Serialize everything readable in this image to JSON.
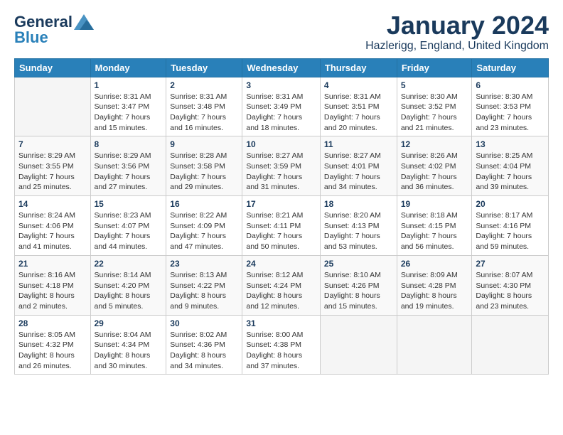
{
  "header": {
    "logo_line1": "General",
    "logo_line2": "Blue",
    "month_title": "January 2024",
    "location": "Hazlerigg, England, United Kingdom"
  },
  "days_of_week": [
    "Sunday",
    "Monday",
    "Tuesday",
    "Wednesday",
    "Thursday",
    "Friday",
    "Saturday"
  ],
  "weeks": [
    [
      {
        "day": "",
        "sunrise": "",
        "sunset": "",
        "daylight": ""
      },
      {
        "day": "1",
        "sunrise": "Sunrise: 8:31 AM",
        "sunset": "Sunset: 3:47 PM",
        "daylight": "Daylight: 7 hours and 15 minutes."
      },
      {
        "day": "2",
        "sunrise": "Sunrise: 8:31 AM",
        "sunset": "Sunset: 3:48 PM",
        "daylight": "Daylight: 7 hours and 16 minutes."
      },
      {
        "day": "3",
        "sunrise": "Sunrise: 8:31 AM",
        "sunset": "Sunset: 3:49 PM",
        "daylight": "Daylight: 7 hours and 18 minutes."
      },
      {
        "day": "4",
        "sunrise": "Sunrise: 8:31 AM",
        "sunset": "Sunset: 3:51 PM",
        "daylight": "Daylight: 7 hours and 20 minutes."
      },
      {
        "day": "5",
        "sunrise": "Sunrise: 8:30 AM",
        "sunset": "Sunset: 3:52 PM",
        "daylight": "Daylight: 7 hours and 21 minutes."
      },
      {
        "day": "6",
        "sunrise": "Sunrise: 8:30 AM",
        "sunset": "Sunset: 3:53 PM",
        "daylight": "Daylight: 7 hours and 23 minutes."
      }
    ],
    [
      {
        "day": "7",
        "sunrise": "Sunrise: 8:29 AM",
        "sunset": "Sunset: 3:55 PM",
        "daylight": "Daylight: 7 hours and 25 minutes."
      },
      {
        "day": "8",
        "sunrise": "Sunrise: 8:29 AM",
        "sunset": "Sunset: 3:56 PM",
        "daylight": "Daylight: 7 hours and 27 minutes."
      },
      {
        "day": "9",
        "sunrise": "Sunrise: 8:28 AM",
        "sunset": "Sunset: 3:58 PM",
        "daylight": "Daylight: 7 hours and 29 minutes."
      },
      {
        "day": "10",
        "sunrise": "Sunrise: 8:27 AM",
        "sunset": "Sunset: 3:59 PM",
        "daylight": "Daylight: 7 hours and 31 minutes."
      },
      {
        "day": "11",
        "sunrise": "Sunrise: 8:27 AM",
        "sunset": "Sunset: 4:01 PM",
        "daylight": "Daylight: 7 hours and 34 minutes."
      },
      {
        "day": "12",
        "sunrise": "Sunrise: 8:26 AM",
        "sunset": "Sunset: 4:02 PM",
        "daylight": "Daylight: 7 hours and 36 minutes."
      },
      {
        "day": "13",
        "sunrise": "Sunrise: 8:25 AM",
        "sunset": "Sunset: 4:04 PM",
        "daylight": "Daylight: 7 hours and 39 minutes."
      }
    ],
    [
      {
        "day": "14",
        "sunrise": "Sunrise: 8:24 AM",
        "sunset": "Sunset: 4:06 PM",
        "daylight": "Daylight: 7 hours and 41 minutes."
      },
      {
        "day": "15",
        "sunrise": "Sunrise: 8:23 AM",
        "sunset": "Sunset: 4:07 PM",
        "daylight": "Daylight: 7 hours and 44 minutes."
      },
      {
        "day": "16",
        "sunrise": "Sunrise: 8:22 AM",
        "sunset": "Sunset: 4:09 PM",
        "daylight": "Daylight: 7 hours and 47 minutes."
      },
      {
        "day": "17",
        "sunrise": "Sunrise: 8:21 AM",
        "sunset": "Sunset: 4:11 PM",
        "daylight": "Daylight: 7 hours and 50 minutes."
      },
      {
        "day": "18",
        "sunrise": "Sunrise: 8:20 AM",
        "sunset": "Sunset: 4:13 PM",
        "daylight": "Daylight: 7 hours and 53 minutes."
      },
      {
        "day": "19",
        "sunrise": "Sunrise: 8:18 AM",
        "sunset": "Sunset: 4:15 PM",
        "daylight": "Daylight: 7 hours and 56 minutes."
      },
      {
        "day": "20",
        "sunrise": "Sunrise: 8:17 AM",
        "sunset": "Sunset: 4:16 PM",
        "daylight": "Daylight: 7 hours and 59 minutes."
      }
    ],
    [
      {
        "day": "21",
        "sunrise": "Sunrise: 8:16 AM",
        "sunset": "Sunset: 4:18 PM",
        "daylight": "Daylight: 8 hours and 2 minutes."
      },
      {
        "day": "22",
        "sunrise": "Sunrise: 8:14 AM",
        "sunset": "Sunset: 4:20 PM",
        "daylight": "Daylight: 8 hours and 5 minutes."
      },
      {
        "day": "23",
        "sunrise": "Sunrise: 8:13 AM",
        "sunset": "Sunset: 4:22 PM",
        "daylight": "Daylight: 8 hours and 9 minutes."
      },
      {
        "day": "24",
        "sunrise": "Sunrise: 8:12 AM",
        "sunset": "Sunset: 4:24 PM",
        "daylight": "Daylight: 8 hours and 12 minutes."
      },
      {
        "day": "25",
        "sunrise": "Sunrise: 8:10 AM",
        "sunset": "Sunset: 4:26 PM",
        "daylight": "Daylight: 8 hours and 15 minutes."
      },
      {
        "day": "26",
        "sunrise": "Sunrise: 8:09 AM",
        "sunset": "Sunset: 4:28 PM",
        "daylight": "Daylight: 8 hours and 19 minutes."
      },
      {
        "day": "27",
        "sunrise": "Sunrise: 8:07 AM",
        "sunset": "Sunset: 4:30 PM",
        "daylight": "Daylight: 8 hours and 23 minutes."
      }
    ],
    [
      {
        "day": "28",
        "sunrise": "Sunrise: 8:05 AM",
        "sunset": "Sunset: 4:32 PM",
        "daylight": "Daylight: 8 hours and 26 minutes."
      },
      {
        "day": "29",
        "sunrise": "Sunrise: 8:04 AM",
        "sunset": "Sunset: 4:34 PM",
        "daylight": "Daylight: 8 hours and 30 minutes."
      },
      {
        "day": "30",
        "sunrise": "Sunrise: 8:02 AM",
        "sunset": "Sunset: 4:36 PM",
        "daylight": "Daylight: 8 hours and 34 minutes."
      },
      {
        "day": "31",
        "sunrise": "Sunrise: 8:00 AM",
        "sunset": "Sunset: 4:38 PM",
        "daylight": "Daylight: 8 hours and 37 minutes."
      },
      {
        "day": "",
        "sunrise": "",
        "sunset": "",
        "daylight": ""
      },
      {
        "day": "",
        "sunrise": "",
        "sunset": "",
        "daylight": ""
      },
      {
        "day": "",
        "sunrise": "",
        "sunset": "",
        "daylight": ""
      }
    ]
  ]
}
